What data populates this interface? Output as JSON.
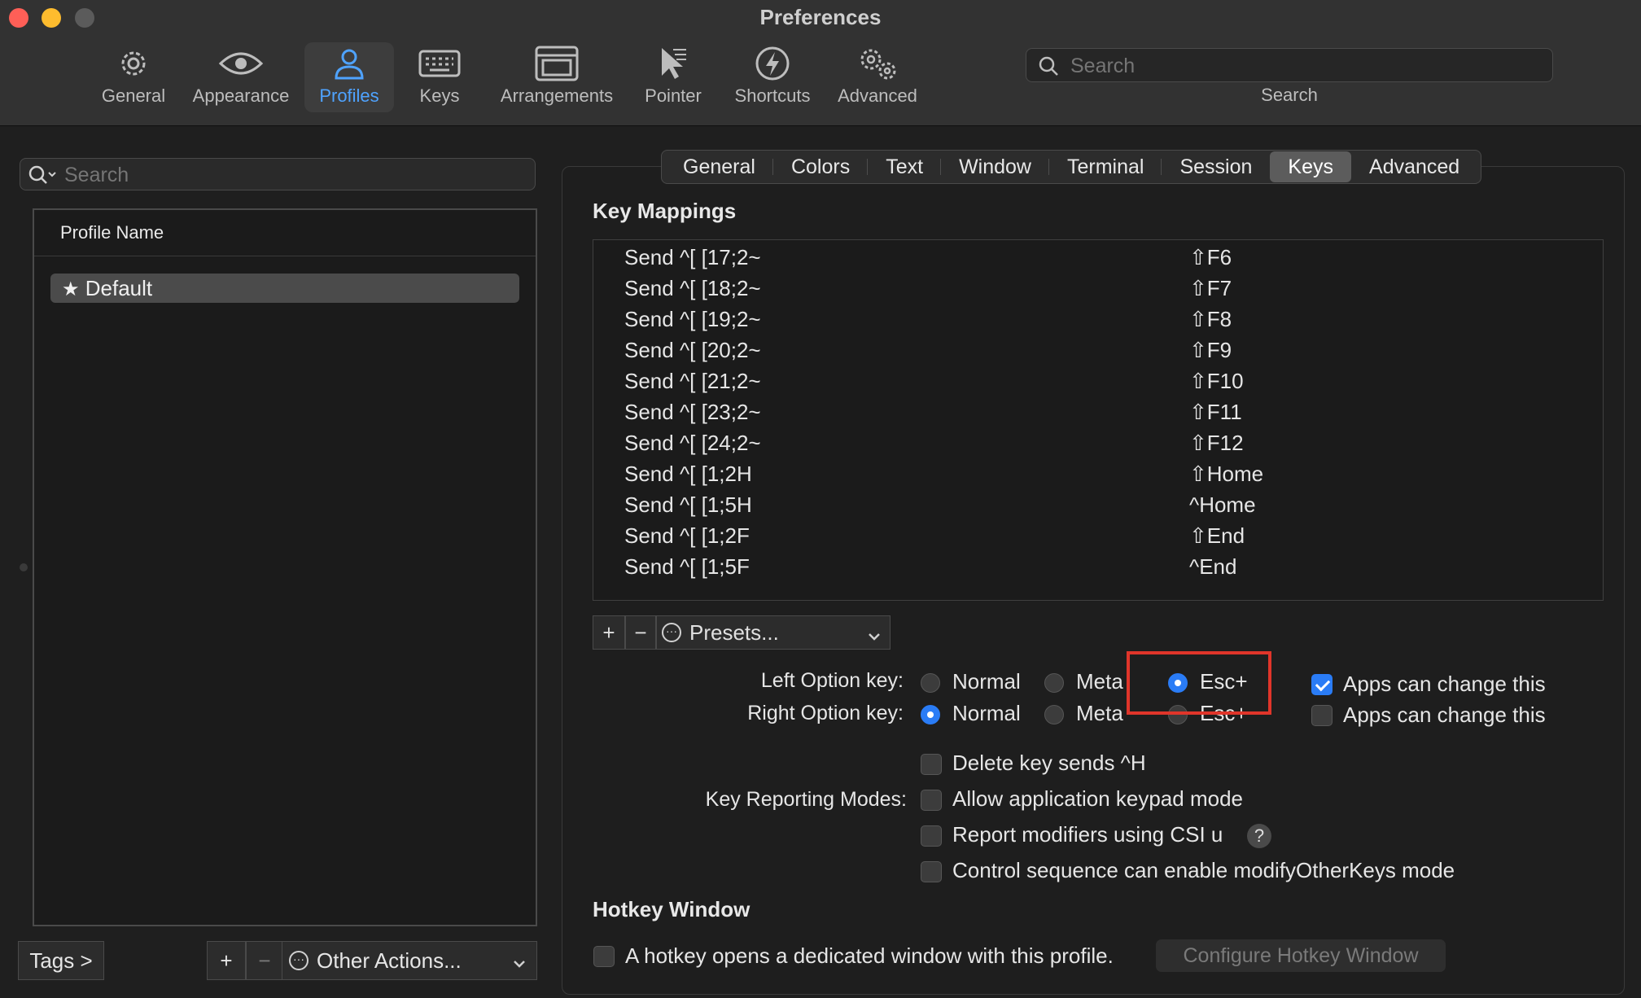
{
  "window": {
    "title": "Preferences"
  },
  "toolbar": {
    "items": [
      {
        "label": "General",
        "icon": "gear-icon"
      },
      {
        "label": "Appearance",
        "icon": "eye-icon"
      },
      {
        "label": "Profiles",
        "icon": "person-icon",
        "active": true
      },
      {
        "label": "Keys",
        "icon": "keyboard-icon"
      },
      {
        "label": "Arrangements",
        "icon": "window-icon"
      },
      {
        "label": "Pointer",
        "icon": "cursor-icon"
      },
      {
        "label": "Shortcuts",
        "icon": "bolt-icon"
      },
      {
        "label": "Advanced",
        "icon": "gears-icon"
      }
    ],
    "search": {
      "placeholder": "Search",
      "caption": "Search"
    }
  },
  "sidebar": {
    "search_placeholder": "Search",
    "column_header": "Profile Name",
    "profiles": [
      {
        "name": "Default",
        "default": true
      }
    ],
    "tags_button": "Tags >",
    "add_button": "+",
    "remove_button": "−",
    "other_actions": "Other Actions..."
  },
  "tabs": [
    "General",
    "Colors",
    "Text",
    "Window",
    "Terminal",
    "Session",
    "Keys",
    "Advanced"
  ],
  "active_tab": "Keys",
  "key_mappings": {
    "title": "Key Mappings",
    "rows": [
      {
        "action": "Send ^[ [17;2~",
        "key": "⇧F6"
      },
      {
        "action": "Send ^[ [18;2~",
        "key": "⇧F7"
      },
      {
        "action": "Send ^[ [19;2~",
        "key": "⇧F8"
      },
      {
        "action": "Send ^[ [20;2~",
        "key": "⇧F9"
      },
      {
        "action": "Send ^[ [21;2~",
        "key": "⇧F10"
      },
      {
        "action": "Send ^[ [23;2~",
        "key": "⇧F11"
      },
      {
        "action": "Send ^[ [24;2~",
        "key": "⇧F12"
      },
      {
        "action": "Send ^[ [1;2H",
        "key": "⇧Home"
      },
      {
        "action": "Send ^[ [1;5H",
        "key": "^Home"
      },
      {
        "action": "Send ^[ [1;2F",
        "key": "⇧End"
      },
      {
        "action": "Send ^[ [1;5F",
        "key": "^End"
      }
    ],
    "add_button": "+",
    "remove_button": "−",
    "presets_label": "Presets..."
  },
  "option_keys": {
    "left_label": "Left Option key:",
    "right_label": "Right Option key:",
    "options": [
      "Normal",
      "Meta",
      "Esc+"
    ],
    "left_selected": "Esc+",
    "right_selected": "Normal",
    "apps_can_change": "Apps can change this",
    "left_apps_can_change": true,
    "right_apps_can_change": false
  },
  "key_reporting": {
    "label": "Key Reporting Modes:",
    "delete_sends_h": "Delete key sends ^H",
    "allow_keypad": "Allow application keypad mode",
    "report_csi_u": "Report modifiers using CSI u",
    "help": "?",
    "modify_other_keys": "Control sequence can enable modifyOtherKeys mode"
  },
  "hotkey": {
    "title": "Hotkey Window",
    "checkbox_label": "A hotkey opens a dedicated window with this profile.",
    "configure_button": "Configure Hotkey Window"
  },
  "colors": {
    "accent": "#2a7cf6",
    "active_toolbar": "#4fa3ff",
    "highlight": "#e0352a"
  }
}
